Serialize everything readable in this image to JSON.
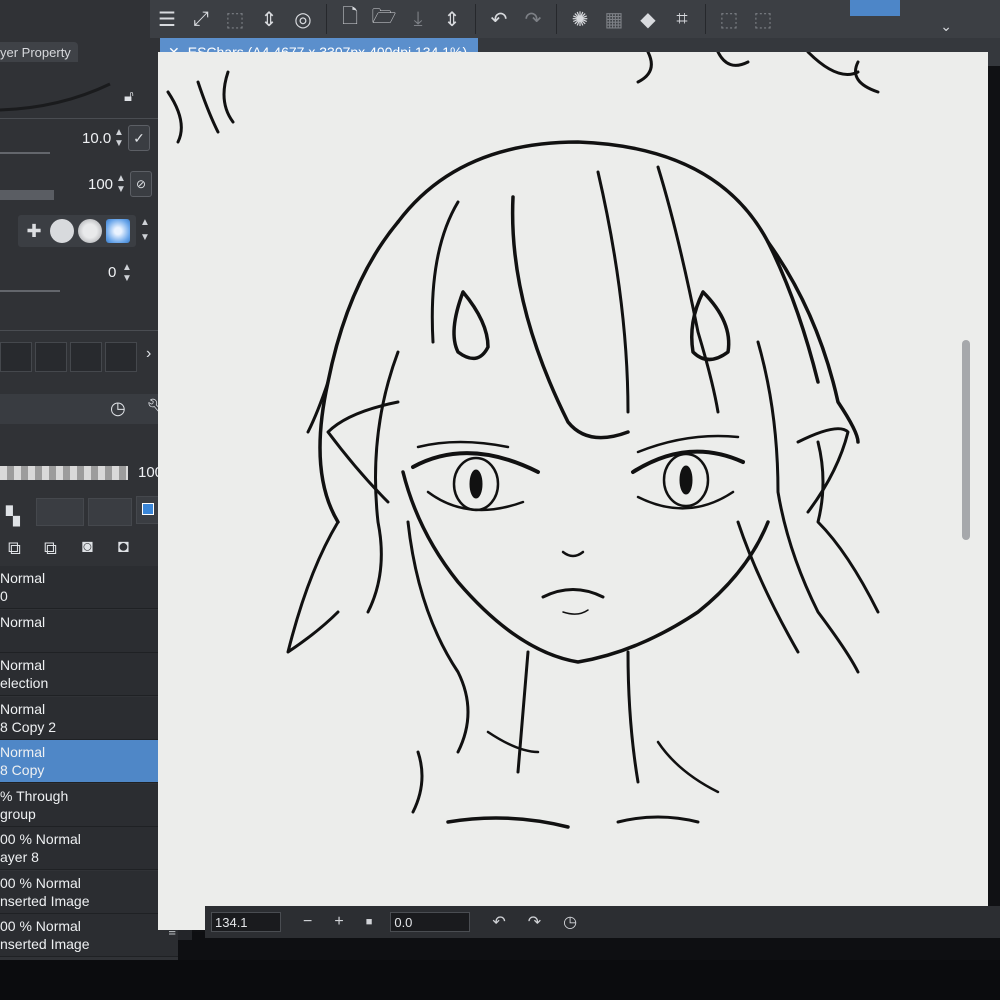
{
  "toolbar": {
    "icons": [
      "menu-icon",
      "fit-screen-icon",
      "transform-icon",
      "updown-icon",
      "spiral-icon",
      "new-file-icon",
      "open-folder-icon",
      "save-icon",
      "updown-icon",
      "undo-icon",
      "redo-icon",
      "loading-icon",
      "clear-icon",
      "fill-icon",
      "crop-icon"
    ]
  },
  "properties": {
    "tab_label": "yer Property",
    "size_value": "10.0",
    "opacity_value": "100",
    "angle_value": "0",
    "layer_opacity": "100"
  },
  "document": {
    "tab_title": "ESChars (A4 4677 x 3307px 400dpi 134.1%)"
  },
  "layers": [
    {
      "line1": "Normal",
      "line2": "0",
      "selected": false
    },
    {
      "line1": "Normal",
      "line2": "",
      "selected": false
    },
    {
      "line1": "Normal",
      "line2": "election",
      "selected": false
    },
    {
      "line1": "Normal",
      "line2": "8 Copy 2",
      "selected": false
    },
    {
      "line1": "Normal",
      "line2": "8 Copy",
      "selected": true
    },
    {
      "line1": "% Through",
      "line2": "group",
      "selected": false
    },
    {
      "line1": "00 % Normal",
      "line2": "ayer 8",
      "selected": false
    },
    {
      "line1": "00 % Normal",
      "line2": "nserted Image",
      "selected": false
    },
    {
      "line1": "00 % Normal",
      "line2": "nserted Image",
      "selected": false
    }
  ],
  "statusbar": {
    "zoom": "134.1",
    "rotation": "0.0"
  },
  "colors": {
    "accent": "#4f87c7",
    "panel": "#303236",
    "canvas": "#ecedeb"
  }
}
